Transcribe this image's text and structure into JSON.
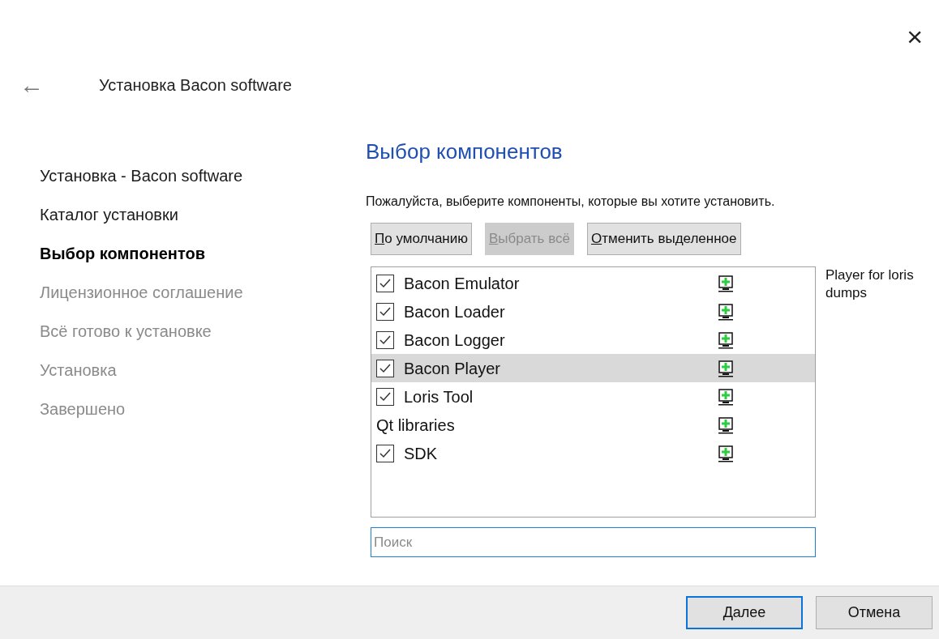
{
  "window": {
    "close": "×"
  },
  "header": {
    "back": "←",
    "title": "Установка Bacon software"
  },
  "steps": [
    {
      "label": "Установка - Bacon software",
      "current": false,
      "disabled": false
    },
    {
      "label": "Каталог установки",
      "current": false,
      "disabled": false
    },
    {
      "label": "Выбор компонентов",
      "current": true,
      "disabled": false
    },
    {
      "label": "Лицензионное соглашение",
      "current": false,
      "disabled": true
    },
    {
      "label": "Всё готово к установке",
      "current": false,
      "disabled": true
    },
    {
      "label": "Установка",
      "current": false,
      "disabled": true
    },
    {
      "label": "Завершено",
      "current": false,
      "disabled": true
    }
  ],
  "page": {
    "heading": "Выбор компонентов",
    "description": "Пожалуйста, выберите компоненты, которые вы хотите установить."
  },
  "actions": [
    {
      "label": "По умолчанию",
      "disabled": false
    },
    {
      "label": "Выбрать всё",
      "disabled": true
    },
    {
      "label": "Отменить выделенное",
      "disabled": false
    }
  ],
  "components": [
    {
      "kind": "checkbox",
      "name": "Bacon Emulator",
      "checked": true,
      "selected": false
    },
    {
      "kind": "checkbox",
      "name": "Bacon Loader",
      "checked": true,
      "selected": false
    },
    {
      "kind": "checkbox",
      "name": "Bacon Logger",
      "checked": true,
      "selected": false
    },
    {
      "kind": "checkbox",
      "name": "Bacon Player",
      "checked": true,
      "selected": true
    },
    {
      "kind": "checkbox",
      "name": "Loris Tool",
      "checked": true,
      "selected": false
    },
    {
      "kind": "group",
      "name": "Qt libraries",
      "selected": false
    },
    {
      "kind": "checkbox",
      "name": "SDK",
      "checked": true,
      "selected": false
    }
  ],
  "component_description": "Player for loris dumps",
  "search": {
    "placeholder": "Поиск"
  },
  "footer": {
    "buttons": [
      {
        "label": "Далее",
        "default": true
      },
      {
        "label": "Отмена",
        "default": false
      }
    ]
  }
}
